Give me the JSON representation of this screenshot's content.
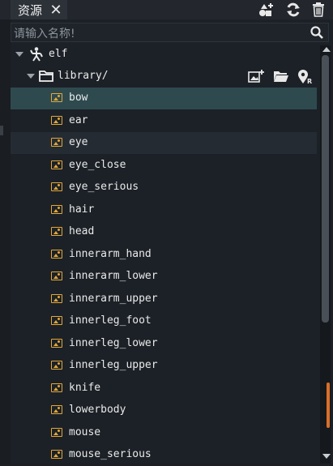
{
  "tab": {
    "label": "资源",
    "close_glyph": "✕"
  },
  "toolbar": {
    "add_icon": "add-asset-icon",
    "refresh_icon": "refresh-icon",
    "delete_icon": "trash-icon"
  },
  "search": {
    "placeholder": "请输入名称!"
  },
  "tree": {
    "root": {
      "label": "elf",
      "icon": "person-icon"
    },
    "folder": {
      "label": "library/",
      "icon": "folder-icon"
    },
    "folder_actions": {
      "import_icon": "import-image-icon",
      "open_folder_icon": "open-folder-icon",
      "locate_icon": "locate-resource-icon",
      "locate_badge": "R"
    },
    "items": [
      "bow",
      "ear",
      "eye",
      "eye_close",
      "eye_serious",
      "hair",
      "head",
      "innerarm_hand",
      "innerarm_lower",
      "innerarm_upper",
      "innerleg_foot",
      "innerleg_lower",
      "innerleg_upper",
      "knife",
      "lowerbody",
      "mouse",
      "mouse_serious"
    ],
    "selected_item": "bow",
    "hovered_item": "eye"
  },
  "colors": {
    "accent": "#e3a83a",
    "selection": "#2e4a4f",
    "scroll_marker": "#d86f2b"
  },
  "scrollbar": {
    "position_fraction": 0.85
  }
}
